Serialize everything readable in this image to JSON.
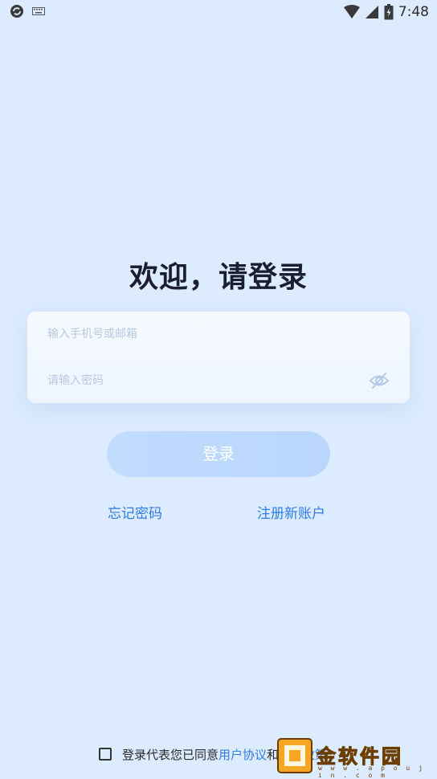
{
  "status_bar": {
    "time": "7:48",
    "icons": [
      "sync-icon",
      "keyboard-icon",
      "wifi-icon",
      "signal-icon",
      "battery-icon"
    ]
  },
  "login": {
    "title": "欢迎，请登录",
    "phone_placeholder": "输入手机号或邮箱",
    "password_placeholder": "请输入密码",
    "login_button": "登录",
    "forgot_password": "忘记密码",
    "register": "注册新账户"
  },
  "agreement": {
    "prefix": "登录代表您已同意",
    "user_agreement": "用户协议",
    "and": "和",
    "privacy_policy": "隐私政策"
  },
  "watermark": {
    "text": "金软件园",
    "url": "w w w . a p o u j i n . c o m"
  },
  "colors": {
    "background": "#dcebfd",
    "accent": "#2f7de3",
    "button": "#bcd9fe",
    "title": "#1b1e2e"
  }
}
